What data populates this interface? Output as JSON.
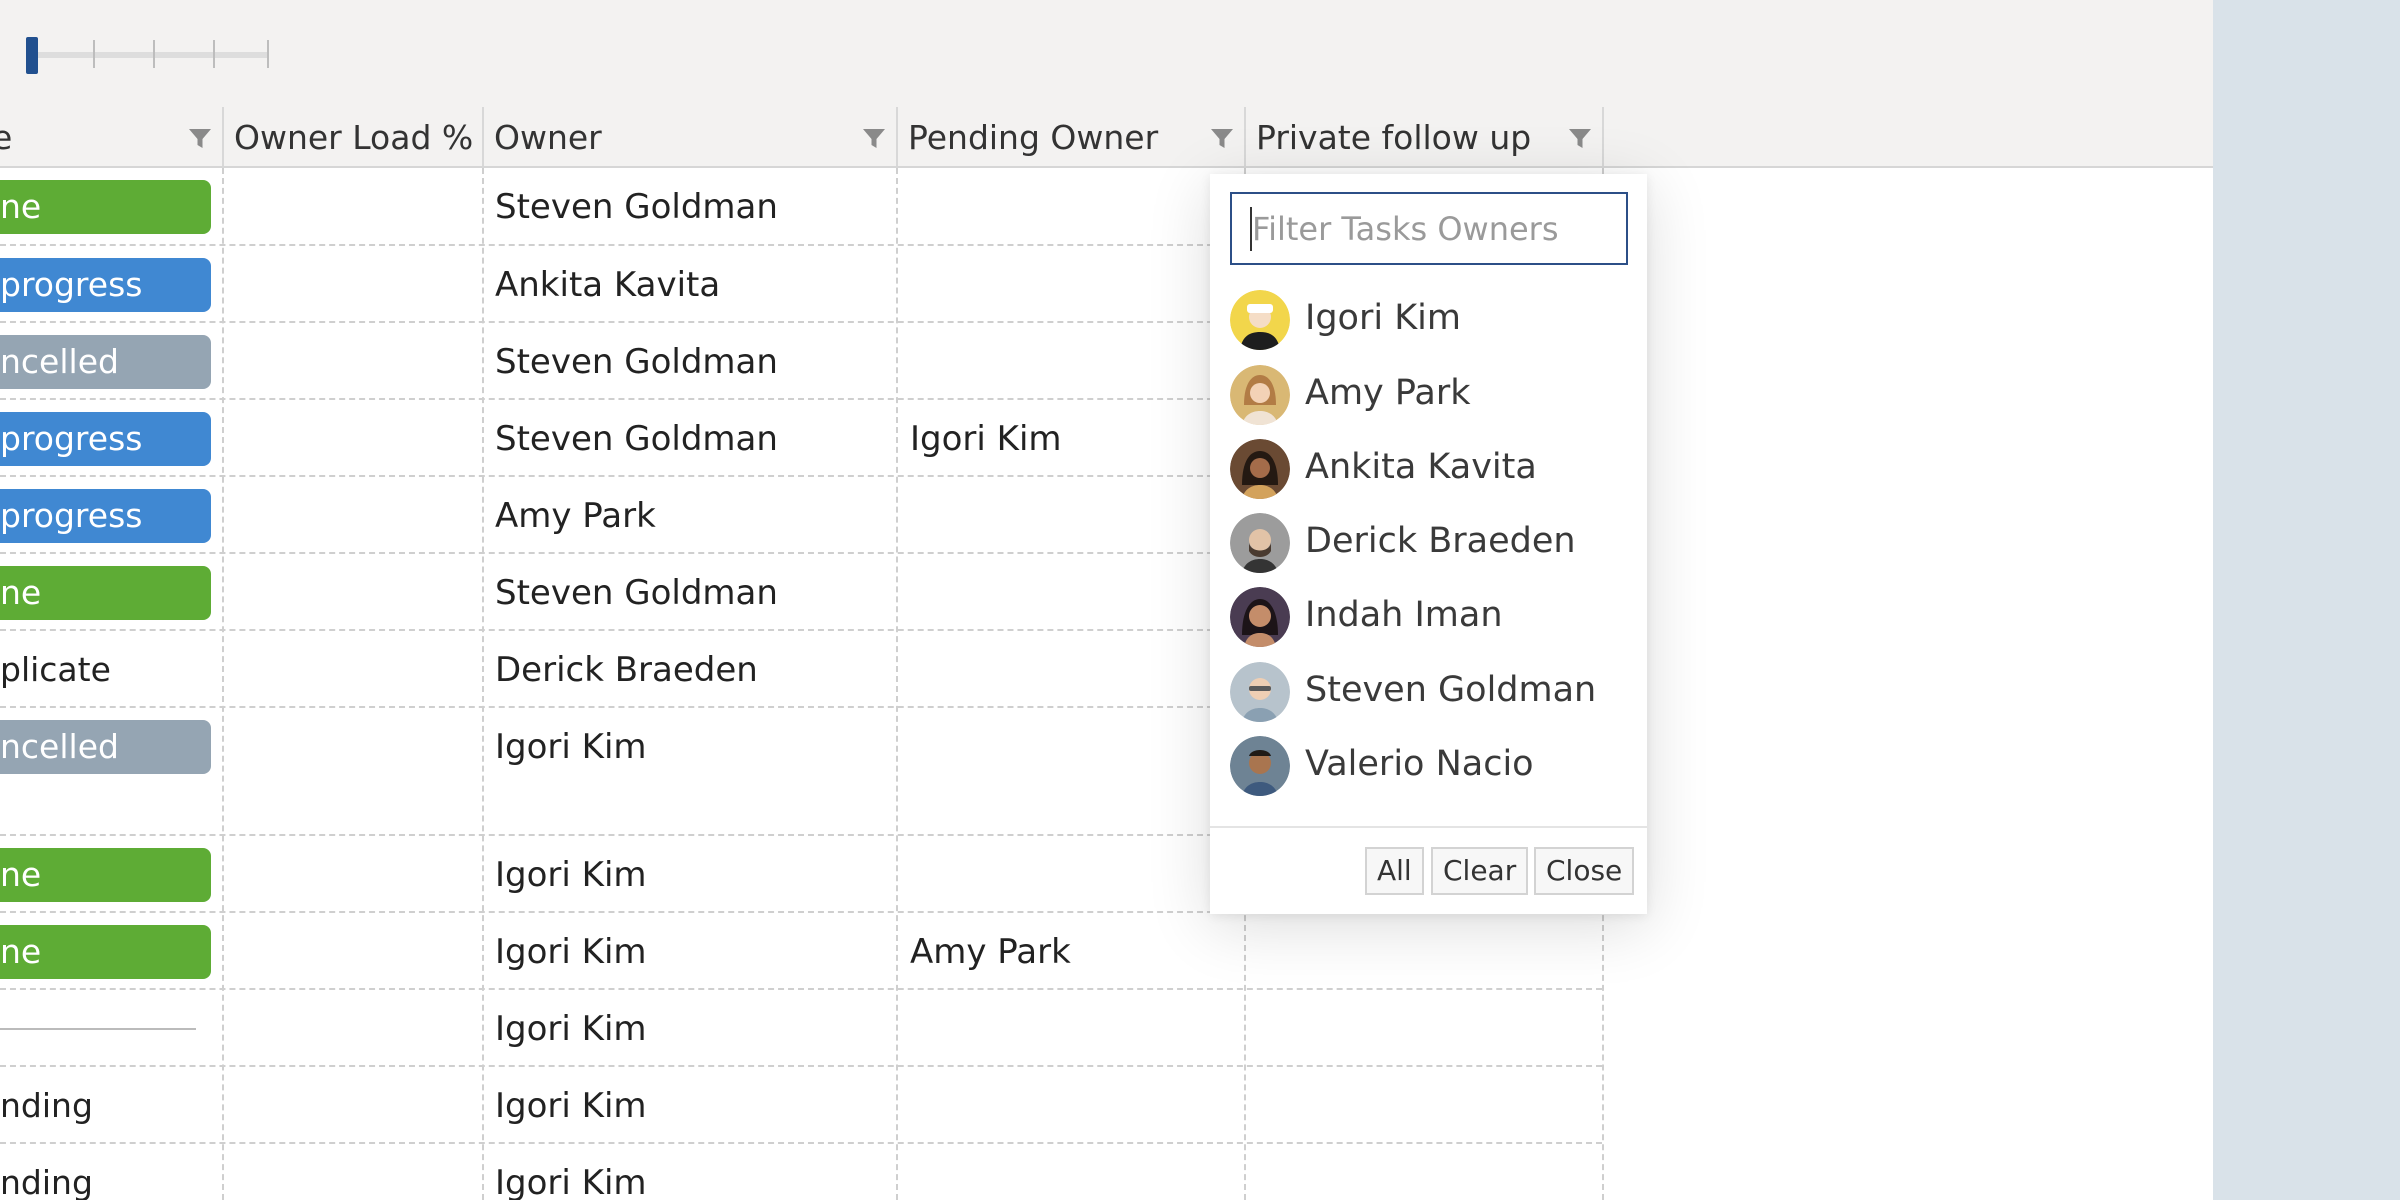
{
  "header": {
    "columns": [
      {
        "label": "e"
      },
      {
        "label": "Owner Load %"
      },
      {
        "label": "Owner"
      },
      {
        "label": "Pending Owner"
      },
      {
        "label": "Private follow up"
      }
    ]
  },
  "rows": [
    {
      "status": "ne",
      "status_color": "#5eac35",
      "owner": "Steven Goldman",
      "pending": ""
    },
    {
      "status": "progress",
      "status_color": "#4088d2",
      "owner": "Ankita Kavita",
      "pending": ""
    },
    {
      "status": "ncelled",
      "status_color": "#95a5b3",
      "owner": "Steven Goldman",
      "pending": ""
    },
    {
      "status": "progress",
      "status_color": "#4088d2",
      "owner": "Steven Goldman",
      "pending": "Igori Kim"
    },
    {
      "status": "progress",
      "status_color": "#4088d2",
      "owner": "Amy Park",
      "pending": ""
    },
    {
      "status": "ne",
      "status_color": "#5eac35",
      "owner": "Steven Goldman",
      "pending": ""
    },
    {
      "status": "plicate",
      "status_color": "",
      "owner": "Derick Braeden",
      "pending": ""
    },
    {
      "status": "ncelled",
      "status_color": "#95a5b3",
      "owner": "Igori Kim",
      "pending": ""
    },
    {
      "status": "ne",
      "status_color": "#5eac35",
      "owner": "Igori Kim",
      "pending": ""
    },
    {
      "status": "ne",
      "status_color": "#5eac35",
      "owner": "Igori Kim",
      "pending": "Amy Park"
    },
    {
      "status": "",
      "status_color": "",
      "owner": "Igori Kim",
      "pending": ""
    },
    {
      "status": "nding",
      "status_color": "",
      "owner": "Igori Kim",
      "pending": ""
    },
    {
      "status": "nding",
      "status_color": "",
      "owner": "Igori Kim",
      "pending": ""
    }
  ],
  "filter_popup": {
    "placeholder": "Filter Tasks Owners",
    "options": [
      {
        "name": "Igori Kim",
        "avatar_bg": "#f2d64b"
      },
      {
        "name": "Amy Park",
        "avatar_bg": "#d9b874"
      },
      {
        "name": "Ankita Kavita",
        "avatar_bg": "#6a4a33"
      },
      {
        "name": "Derick Braeden",
        "avatar_bg": "#9c9c9c"
      },
      {
        "name": "Indah Iman",
        "avatar_bg": "#4a3c52"
      },
      {
        "name": "Steven Goldman",
        "avatar_bg": "#b7c3cc"
      },
      {
        "name": "Valerio Nacio",
        "avatar_bg": "#6e8394"
      }
    ],
    "buttons": {
      "all": "All",
      "clear": "Clear",
      "close": "Close"
    }
  },
  "colors": {
    "slider_thumb": "#21508f",
    "done": "#5eac35",
    "in_progress": "#4088d2",
    "cancelled": "#95a5b3",
    "input_border": "#2c4f87"
  }
}
